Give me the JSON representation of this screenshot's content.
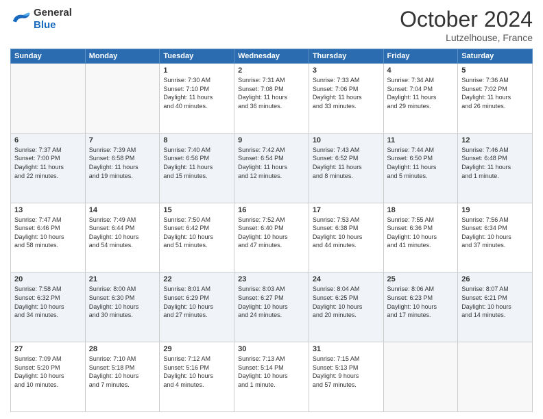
{
  "header": {
    "logo": {
      "general": "General",
      "blue": "Blue"
    },
    "month": "October 2024",
    "location": "Lutzelhouse, France"
  },
  "columns": [
    "Sunday",
    "Monday",
    "Tuesday",
    "Wednesday",
    "Thursday",
    "Friday",
    "Saturday"
  ],
  "weeks": [
    {
      "days": [
        {
          "num": "",
          "info": ""
        },
        {
          "num": "",
          "info": ""
        },
        {
          "num": "1",
          "info": "Sunrise: 7:30 AM\nSunset: 7:10 PM\nDaylight: 11 hours\nand 40 minutes."
        },
        {
          "num": "2",
          "info": "Sunrise: 7:31 AM\nSunset: 7:08 PM\nDaylight: 11 hours\nand 36 minutes."
        },
        {
          "num": "3",
          "info": "Sunrise: 7:33 AM\nSunset: 7:06 PM\nDaylight: 11 hours\nand 33 minutes."
        },
        {
          "num": "4",
          "info": "Sunrise: 7:34 AM\nSunset: 7:04 PM\nDaylight: 11 hours\nand 29 minutes."
        },
        {
          "num": "5",
          "info": "Sunrise: 7:36 AM\nSunset: 7:02 PM\nDaylight: 11 hours\nand 26 minutes."
        }
      ]
    },
    {
      "days": [
        {
          "num": "6",
          "info": "Sunrise: 7:37 AM\nSunset: 7:00 PM\nDaylight: 11 hours\nand 22 minutes."
        },
        {
          "num": "7",
          "info": "Sunrise: 7:39 AM\nSunset: 6:58 PM\nDaylight: 11 hours\nand 19 minutes."
        },
        {
          "num": "8",
          "info": "Sunrise: 7:40 AM\nSunset: 6:56 PM\nDaylight: 11 hours\nand 15 minutes."
        },
        {
          "num": "9",
          "info": "Sunrise: 7:42 AM\nSunset: 6:54 PM\nDaylight: 11 hours\nand 12 minutes."
        },
        {
          "num": "10",
          "info": "Sunrise: 7:43 AM\nSunset: 6:52 PM\nDaylight: 11 hours\nand 8 minutes."
        },
        {
          "num": "11",
          "info": "Sunrise: 7:44 AM\nSunset: 6:50 PM\nDaylight: 11 hours\nand 5 minutes."
        },
        {
          "num": "12",
          "info": "Sunrise: 7:46 AM\nSunset: 6:48 PM\nDaylight: 11 hours\nand 1 minute."
        }
      ]
    },
    {
      "days": [
        {
          "num": "13",
          "info": "Sunrise: 7:47 AM\nSunset: 6:46 PM\nDaylight: 10 hours\nand 58 minutes."
        },
        {
          "num": "14",
          "info": "Sunrise: 7:49 AM\nSunset: 6:44 PM\nDaylight: 10 hours\nand 54 minutes."
        },
        {
          "num": "15",
          "info": "Sunrise: 7:50 AM\nSunset: 6:42 PM\nDaylight: 10 hours\nand 51 minutes."
        },
        {
          "num": "16",
          "info": "Sunrise: 7:52 AM\nSunset: 6:40 PM\nDaylight: 10 hours\nand 47 minutes."
        },
        {
          "num": "17",
          "info": "Sunrise: 7:53 AM\nSunset: 6:38 PM\nDaylight: 10 hours\nand 44 minutes."
        },
        {
          "num": "18",
          "info": "Sunrise: 7:55 AM\nSunset: 6:36 PM\nDaylight: 10 hours\nand 41 minutes."
        },
        {
          "num": "19",
          "info": "Sunrise: 7:56 AM\nSunset: 6:34 PM\nDaylight: 10 hours\nand 37 minutes."
        }
      ]
    },
    {
      "days": [
        {
          "num": "20",
          "info": "Sunrise: 7:58 AM\nSunset: 6:32 PM\nDaylight: 10 hours\nand 34 minutes."
        },
        {
          "num": "21",
          "info": "Sunrise: 8:00 AM\nSunset: 6:30 PM\nDaylight: 10 hours\nand 30 minutes."
        },
        {
          "num": "22",
          "info": "Sunrise: 8:01 AM\nSunset: 6:29 PM\nDaylight: 10 hours\nand 27 minutes."
        },
        {
          "num": "23",
          "info": "Sunrise: 8:03 AM\nSunset: 6:27 PM\nDaylight: 10 hours\nand 24 minutes."
        },
        {
          "num": "24",
          "info": "Sunrise: 8:04 AM\nSunset: 6:25 PM\nDaylight: 10 hours\nand 20 minutes."
        },
        {
          "num": "25",
          "info": "Sunrise: 8:06 AM\nSunset: 6:23 PM\nDaylight: 10 hours\nand 17 minutes."
        },
        {
          "num": "26",
          "info": "Sunrise: 8:07 AM\nSunset: 6:21 PM\nDaylight: 10 hours\nand 14 minutes."
        }
      ]
    },
    {
      "days": [
        {
          "num": "27",
          "info": "Sunrise: 7:09 AM\nSunset: 5:20 PM\nDaylight: 10 hours\nand 10 minutes."
        },
        {
          "num": "28",
          "info": "Sunrise: 7:10 AM\nSunset: 5:18 PM\nDaylight: 10 hours\nand 7 minutes."
        },
        {
          "num": "29",
          "info": "Sunrise: 7:12 AM\nSunset: 5:16 PM\nDaylight: 10 hours\nand 4 minutes."
        },
        {
          "num": "30",
          "info": "Sunrise: 7:13 AM\nSunset: 5:14 PM\nDaylight: 10 hours\nand 1 minute."
        },
        {
          "num": "31",
          "info": "Sunrise: 7:15 AM\nSunset: 5:13 PM\nDaylight: 9 hours\nand 57 minutes."
        },
        {
          "num": "",
          "info": ""
        },
        {
          "num": "",
          "info": ""
        }
      ]
    }
  ]
}
